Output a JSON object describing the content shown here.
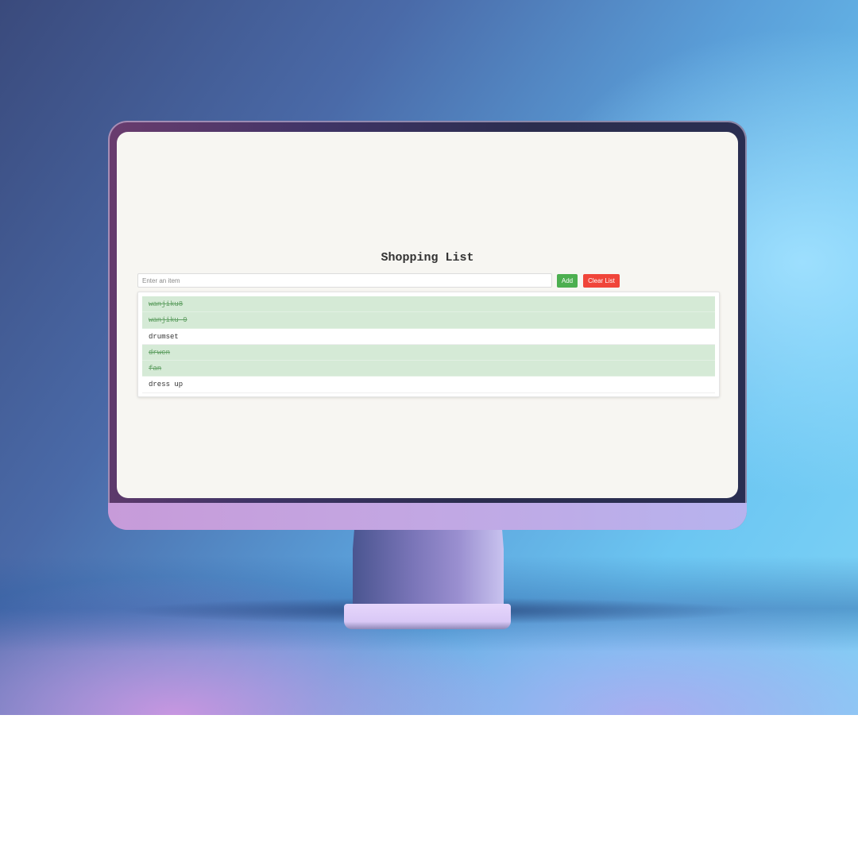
{
  "app": {
    "title": "Shopping List",
    "input": {
      "placeholder": "Enter an item",
      "value": ""
    },
    "add_label": "Add",
    "clear_label": "Clear List",
    "items": [
      {
        "label": "wanjiku8",
        "completed": true
      },
      {
        "label": "wanjiku 9",
        "completed": true
      },
      {
        "label": "drumset",
        "completed": false
      },
      {
        "label": "drwcn",
        "completed": true
      },
      {
        "label": "fan",
        "completed": true
      },
      {
        "label": "dress up",
        "completed": false
      }
    ]
  },
  "colors": {
    "add_button": "#4caf50",
    "clear_button": "#f0453a",
    "completed_bg": "#d5ead6",
    "completed_text": "#5f9f62",
    "screen_bg": "#f7f6f2"
  }
}
